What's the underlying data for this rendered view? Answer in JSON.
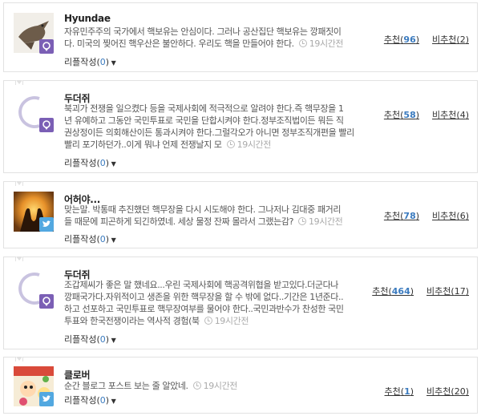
{
  "comments": [
    {
      "author": "Hyundae",
      "badge": "purple",
      "lines": [
        "자유민주주의 국가에서 핵보유는 안심이다. 그러나 공산집단 핵보유는 깡패짓이",
        "다. 미국의 찢어진 핵우산은 불안하다. 우리도 핵을 만들어야 한다."
      ],
      "time": "19시간전",
      "reply_label": "리플작성",
      "reply_count": "0",
      "recommend_label": "추천",
      "recommend_count": "96",
      "notrecommend_label": "비추천",
      "notrecommend_count": "2"
    },
    {
      "author": "두더쥐",
      "badge": "purple",
      "lines": [
        "북괴가 전쟁을 일으켰다 등을 국제사회에 적극적으로 알려야 한다.즉 핵무장을 1",
        "년 유예하고 그동안 국민투표로 국민을 단합시켜야 한다.정부조직법이든 뭐든 직",
        "권상정이든 의회해산이든 통과시켜야 한다.그럴각오가 아니면 정부조직개편을 빨리",
        "빨리 포기하던가..이게 뭐냐 언제 전쟁날지 모"
      ],
      "time": "19시간전",
      "reply_label": "리플작성",
      "reply_count": "0",
      "recommend_label": "추천",
      "recommend_count": "58",
      "notrecommend_label": "비추천",
      "notrecommend_count": "4"
    },
    {
      "author": "어허야...",
      "badge": "twitter",
      "lines": [
        "맞는말. 박통때 추진했던 핵무장을 다시 시도해야 한다. 그나저나 김대중 패거리",
        "들 때문에 피곤하게 되긴하였네. 세상 물정 잔짜 몰라서 그랬는감?"
      ],
      "time": "19시간전",
      "reply_label": "리플작성",
      "reply_count": "0",
      "recommend_label": "추천",
      "recommend_count": "78",
      "notrecommend_label": "비추천",
      "notrecommend_count": "6"
    },
    {
      "author": "두더쥐",
      "badge": "purple",
      "lines": [
        "조갑제씨가 좋은 말 했네요...우린 국제사회에 핵공격위협을 받고있다.더군다나",
        "깡패국가다.자위적이고 생존을 위한 핵무장을 할 수 밖에 없다..기간은 1년준다..",
        "하고 선포하고 국민투표로 핵무장여부를 물어야 한다..국민과반수가 찬성한 국민",
        "투표와 한국전쟁이라는 역사적 경험(북"
      ],
      "time": "19시간전",
      "reply_label": "리플작성",
      "reply_count": "0",
      "recommend_label": "추천",
      "recommend_count": "464",
      "notrecommend_label": "비추천",
      "notrecommend_count": "17"
    },
    {
      "author": "클로버",
      "badge": "twitter",
      "lines": [
        "순간 블로그 포스트 보는 줄 알았네."
      ],
      "time": "19시간전",
      "reply_label": "리플작성",
      "reply_count": "0",
      "recommend_label": "추천",
      "recommend_count": "1",
      "notrecommend_label": "비추천",
      "notrecommend_count": "20"
    }
  ]
}
